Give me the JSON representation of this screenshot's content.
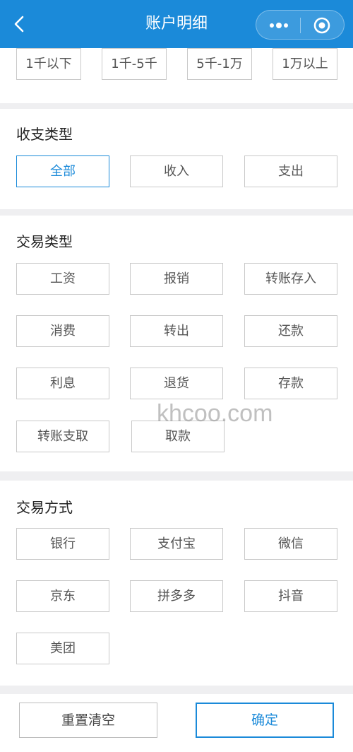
{
  "header": {
    "title": "账户明细",
    "back_icon": "chevron-left-icon",
    "more_icon": "more-dots-icon",
    "close_icon": "target-circle-icon",
    "bg_color": "#1b8ad9"
  },
  "amount_range": {
    "options": [
      "1千以下",
      "1千-5千",
      "5千-1万",
      "1万以上"
    ]
  },
  "income_type": {
    "title": "收支类型",
    "options": [
      "全部",
      "收入",
      "支出"
    ],
    "selected": "全部"
  },
  "transaction_type": {
    "title": "交易类型",
    "options": [
      "工资",
      "报销",
      "转账存入",
      "消费",
      "转出",
      "还款",
      "利息",
      "退货",
      "存款",
      "转账支取",
      "取款"
    ]
  },
  "transaction_method": {
    "title": "交易方式",
    "options": [
      "银行",
      "支付宝",
      "微信",
      "京东",
      "拼多多",
      "抖音",
      "美团"
    ]
  },
  "footer": {
    "reset_label": "重置清空",
    "confirm_label": "确定"
  },
  "watermark": "khcoo.com",
  "accent_color": "#1b8ad9"
}
